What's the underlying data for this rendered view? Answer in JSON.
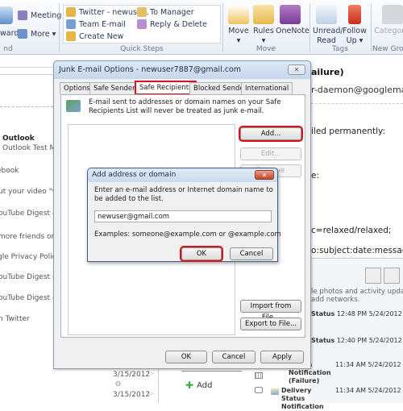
{
  "ribbon": {
    "respond": {
      "forward_partial": "ward",
      "meeting": "Meeting",
      "more": "More ▾",
      "group_label_partial": "nd"
    },
    "quick_steps": {
      "items": [
        "Twitter - newuse...",
        "Team E-mail",
        "Create New",
        "To Manager",
        "Reply & Delete"
      ],
      "group_label": "Quick Steps"
    },
    "move": {
      "buttons": [
        "Move",
        "Rules",
        "OneNote"
      ],
      "group_label": "Move"
    },
    "tags": {
      "buttons": [
        "Unread/ Read",
        "Follow Up ▾"
      ],
      "group_label": "Tags"
    },
    "new_group": {
      "button_partial": "Categoriz",
      "group_label_partial": "New Grou"
    }
  },
  "mail_list": {
    "items": [
      {
        "title": "Outlook",
        "subtitle": "Outlook Test Me"
      },
      {
        "subtitle": "ebook"
      },
      {
        "subtitle": "ut your video \"vid"
      },
      {
        "subtitle": "ouTube Digest - F"
      },
      {
        "subtitle": "more friends on"
      },
      {
        "subtitle": "gle Privacy Policy"
      },
      {
        "subtitle": "ouTube Digest - F"
      },
      {
        "subtitle": "ouTube Digest - M"
      },
      {
        "subtitle": "n Twitter"
      }
    ],
    "dates": [
      "3/15/2012",
      "3/15/2012"
    ]
  },
  "reading_pane": {
    "subject_partial": "ailure)",
    "sender_partial": "r-daemon@googlema",
    "body_lines": [
      "iled permanently:",
      "e:",
      "c=relaxed/relaxed;",
      "o:subject:date:message-"
    ],
    "people_text": [
      "le photos and activity updat",
      "add networks."
    ],
    "add_label": "Add",
    "messages": [
      {
        "title": "Status",
        "time": "12:48 PM",
        "date": "5/24/2012"
      },
      {
        "title": "Status",
        "time": "12:40 PM",
        "date": "5/24/2012"
      },
      {
        "title": "Status Notification (Failure)",
        "time": "11:34 AM",
        "date": "5/24/2012"
      },
      {
        "title": "Delivery Status Notification",
        "time": "11:34 AM",
        "date": "5/24/2012"
      }
    ]
  },
  "junk_dialog": {
    "title": "Junk E-mail Options - newuser7887@gmail.com",
    "tabs": [
      "Options",
      "Safe Senders",
      "Safe Recipients",
      "Blocked Senders",
      "International"
    ],
    "active_tab": "Safe Recipients",
    "description": "E-mail sent to addresses or domain names on your Safe Recipients List will never be treated as junk e-mail.",
    "side_buttons": {
      "add": "Add...",
      "edit": "Edit...",
      "remove": "Remove",
      "import": "Import from File...",
      "export": "Export to File..."
    },
    "footer": {
      "ok": "OK",
      "cancel": "Cancel",
      "apply": "Apply"
    }
  },
  "add_dialog": {
    "title": "Add address or domain",
    "prompt": "Enter an e-mail address or Internet domain name to be added to the list.",
    "input_value": "newuser@gmail.com",
    "examples": "Examples: someone@example.com or @example.com",
    "ok": "OK",
    "cancel": "Cancel"
  },
  "colors": {
    "highlight": "#d9121f",
    "title_bar": "#c6d6ec"
  }
}
